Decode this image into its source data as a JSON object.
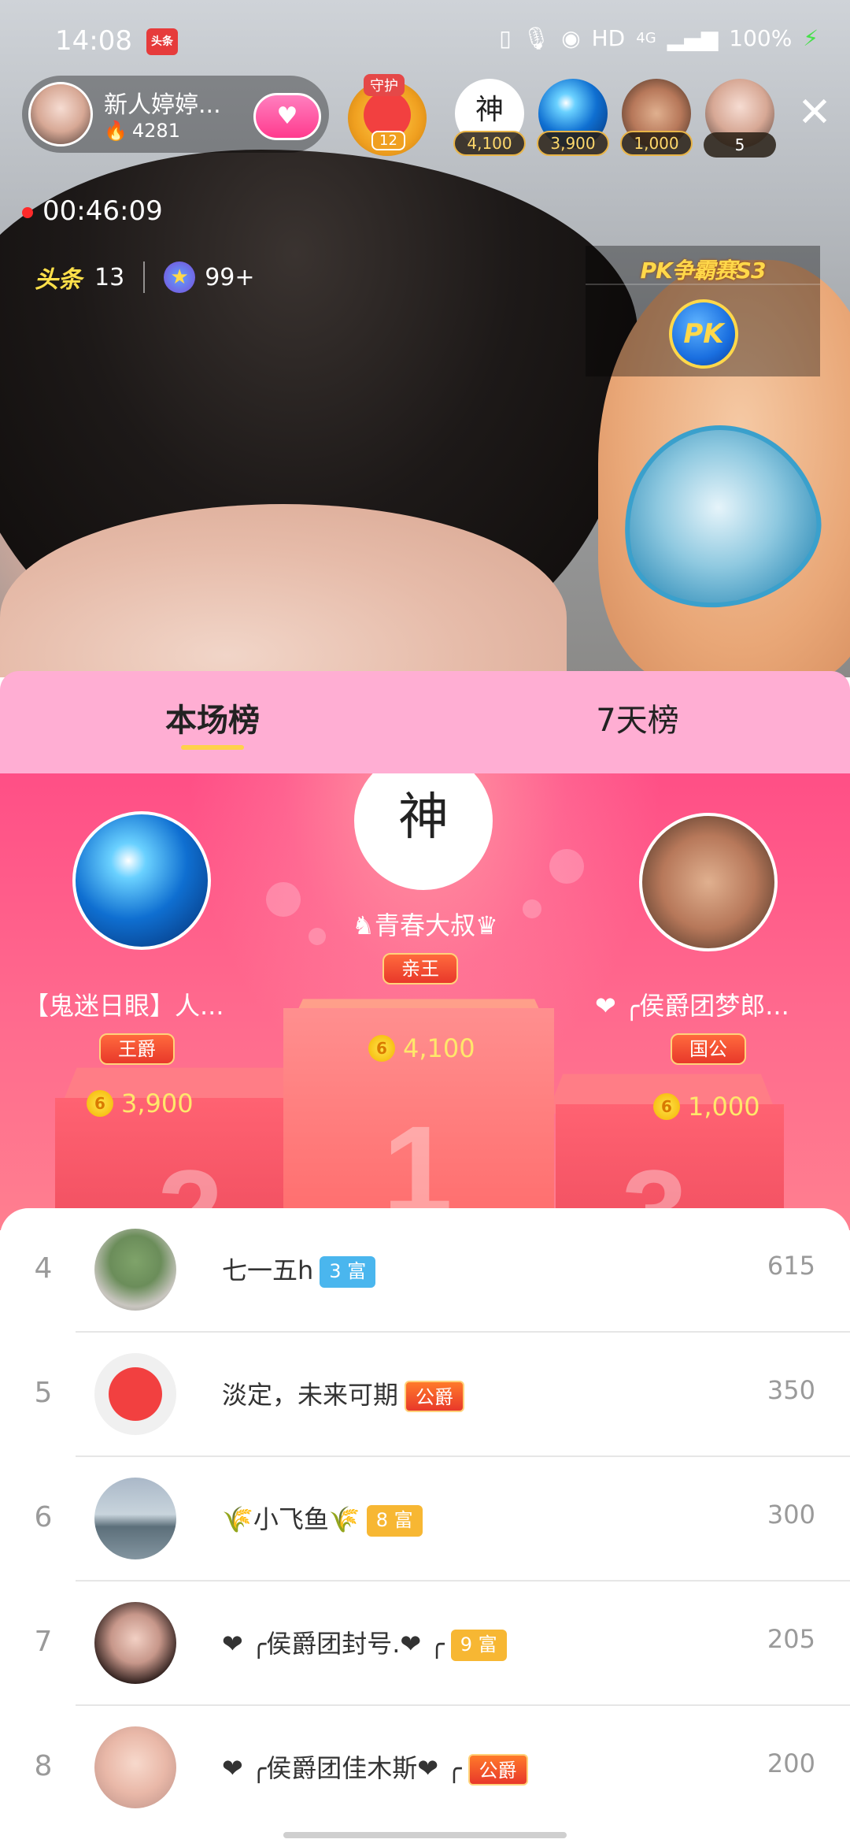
{
  "status_bar": {
    "time": "14:08",
    "app_icon_label": "头条",
    "indicators": "HD",
    "network": "4G",
    "battery": "100%"
  },
  "host": {
    "name": "新人婷婷...",
    "hot_value": "4281"
  },
  "guard": {
    "label": "守护",
    "count": "12"
  },
  "viewers": [
    {
      "avatar": "神",
      "amount": "4,100"
    },
    {
      "avatar": "",
      "amount": "3,900"
    },
    {
      "avatar": "",
      "amount": "1,000"
    }
  ],
  "viewer_count": "5",
  "recording": {
    "timer": "00:46:09"
  },
  "stats": {
    "toutiao_label": "头条",
    "toutiao_count": "13",
    "star_count": "99+"
  },
  "pk": {
    "title": "PK争霸赛S3",
    "button": "PK"
  },
  "tabs": [
    {
      "label": "本场榜",
      "active": true
    },
    {
      "label": "7天榜",
      "active": false
    }
  ],
  "podium": {
    "first": {
      "avatar_text": "神",
      "name": "♞青春大叔♛",
      "badge": "亲王",
      "amount": "4,100",
      "rank_num": "1"
    },
    "second": {
      "name": "【鬼迷日眼】人...",
      "badge": "王爵",
      "amount": "3,900",
      "rank_num": "2"
    },
    "third": {
      "name": "❤ ╭侯爵团梦郎...",
      "badge": "国公",
      "amount": "1,000",
      "rank_num": "3"
    },
    "coin_symbol": "6"
  },
  "ranking": [
    {
      "rank": "4",
      "name": "七一五h",
      "badge": "3 富",
      "score": "615"
    },
    {
      "rank": "5",
      "name": "淡定，未来可期",
      "badge": "公爵",
      "score": "350"
    },
    {
      "rank": "6",
      "name": "🌾小飞鱼🌾",
      "badge": "8 富",
      "score": "300"
    },
    {
      "rank": "7",
      "name": "❤ ╭侯爵团封号.❤ ╭",
      "badge": "9 富",
      "score": "205"
    },
    {
      "rank": "8",
      "name": "❤ ╭侯爵团佳木斯❤ ╭",
      "badge": "公爵",
      "score": "200"
    }
  ],
  "icons": {
    "follow": "heart-wings-icon",
    "close": "close-icon",
    "flame": "flame-icon",
    "star": "star-icon",
    "coin": "coin-icon"
  },
  "colors": {
    "tab_bg": "#ffaed3",
    "podium_bg": "#ff4f86",
    "accent_gold": "#ffd24a",
    "badge_blue": "#4ab6ee",
    "badge_orange": "#f7b733"
  }
}
